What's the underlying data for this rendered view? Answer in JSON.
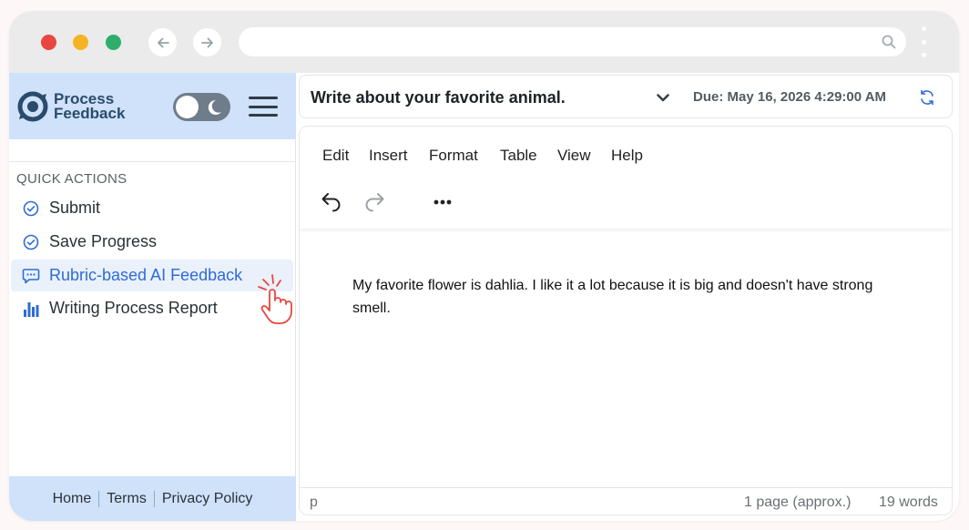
{
  "browser": {
    "traffic_lights": [
      "#e8473f",
      "#f5b323",
      "#2fae6b"
    ],
    "back_icon": "arrow-left-icon",
    "forward_icon": "arrow-right-icon",
    "url": "",
    "search_icon": "search-icon",
    "menu_icon": "kebab-icon"
  },
  "sidebar": {
    "brand_line1": "Process",
    "brand_line2": "Feedback",
    "quick_actions_title": "QUICK ACTIONS",
    "actions": [
      {
        "label": "Submit",
        "icon": "check-circle-icon"
      },
      {
        "label": "Save Progress",
        "icon": "check-circle-icon"
      },
      {
        "label": "Rubric-based AI Feedback",
        "icon": "chat-icon",
        "active": true
      },
      {
        "label": "Writing Process Report",
        "icon": "bar-chart-icon"
      }
    ],
    "footer_links": [
      "Home",
      "Terms",
      "Privacy Policy"
    ]
  },
  "assignment": {
    "title": "Write about your favorite animal.",
    "due": "Due: May 16, 2026 4:29:00 AM"
  },
  "editor": {
    "menus": [
      "Edit",
      "Insert",
      "Format",
      "Table",
      "View",
      "Help"
    ],
    "body": "My favorite flower is dahlia. I like it a lot because it is big and doesn't have strong smell.",
    "status_path": "p",
    "page_count": "1 page (approx.)",
    "word_count": "19 words"
  },
  "colors": {
    "accent": "#2f6bd6",
    "header_bg": "#cfe2fa",
    "brand": "#2a4b6b",
    "cursor_hand": "#e8473f"
  }
}
